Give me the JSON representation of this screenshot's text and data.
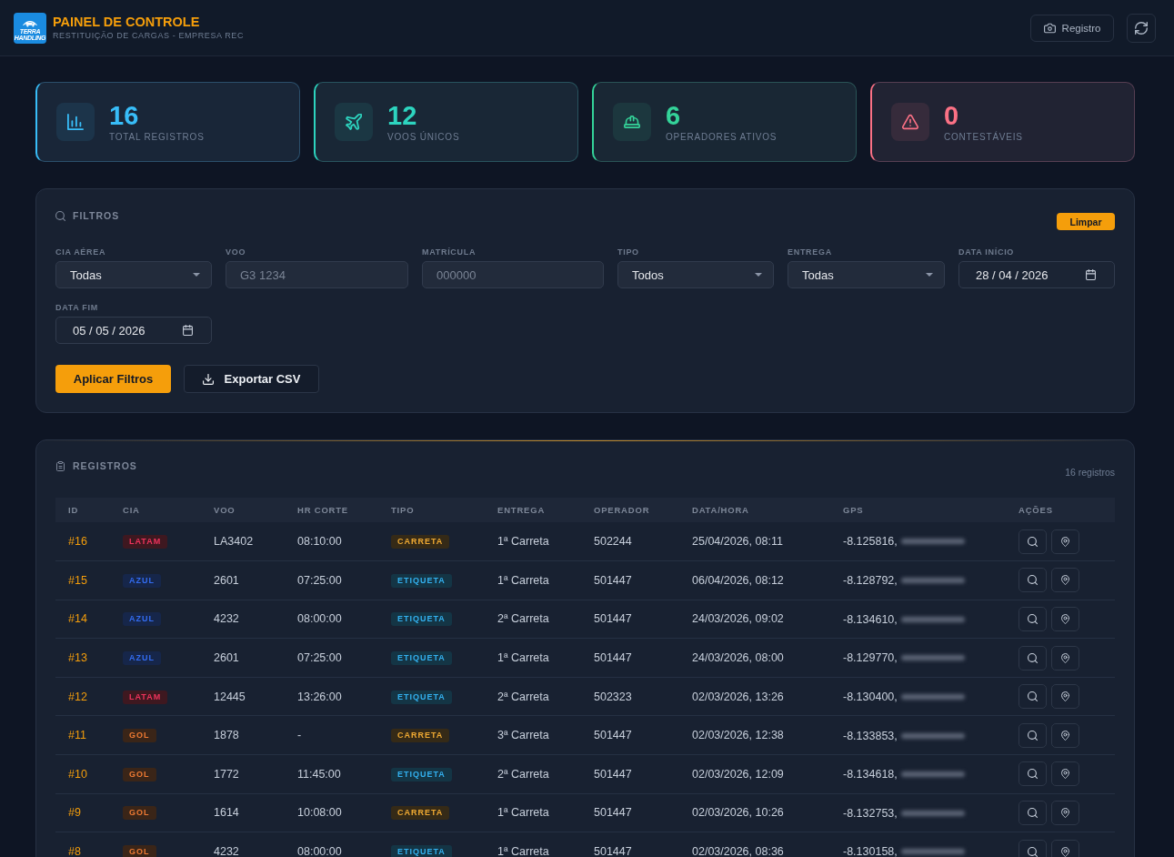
{
  "header": {
    "logo_text": [
      "TERRA",
      "HANDLING"
    ],
    "title": "PAINEL DE CONTROLE",
    "subtitle": "RESTITUIÇÃO DE CARGAS - EMPRESA REC",
    "register_button": "Registro"
  },
  "stats": [
    {
      "kind": "chart",
      "value": "16",
      "label": "TOTAL REGISTROS",
      "color": "#38bdf8"
    },
    {
      "kind": "plane",
      "value": "12",
      "label": "VOOS ÚNICOS",
      "color": "#2dd4bf"
    },
    {
      "kind": "helmet",
      "value": "6",
      "label": "OPERADORES ATIVOS",
      "color": "#34d399"
    },
    {
      "kind": "warning",
      "value": "0",
      "label": "CONTESTÁVEIS",
      "color": "#fb7185"
    }
  ],
  "filters": {
    "title": "FILTROS",
    "clear_button": "Limpar",
    "fields": [
      {
        "kind": "select",
        "label": "CIA AÉREA",
        "value": "Todas"
      },
      {
        "kind": "text",
        "label": "VOO",
        "placeholder": "G3 1234"
      },
      {
        "kind": "text",
        "label": "MATRÍCULA",
        "placeholder": "000000"
      },
      {
        "kind": "select",
        "label": "TIPO",
        "value": "Todos"
      },
      {
        "kind": "select",
        "label": "ENTREGA",
        "value": "Todas"
      },
      {
        "kind": "date",
        "label": "DATA INÍCIO",
        "value": "28 / 04 / 2026"
      },
      {
        "kind": "date",
        "label": "DATA FIM",
        "value": "05 / 05 / 2026"
      }
    ],
    "apply_button": "Aplicar Filtros",
    "export_button": "Exportar CSV"
  },
  "records": {
    "title": "REGISTROS",
    "count": "16 registros",
    "columns": [
      "ID",
      "CIA",
      "VOO",
      "HR CORTE",
      "TIPO",
      "ENTREGA",
      "OPERADOR",
      "DATA/HORA",
      "GPS",
      "AÇÕES"
    ],
    "rows": [
      {
        "id": "#16",
        "cia": {
          "label": "LATAM",
          "color": "#3e1820"
        },
        "voo": "LA3402",
        "hr_corte": "08:10:00",
        "tipo": {
          "label": "CARRETA",
          "color": "#352a17"
        },
        "entrega": "1ª Carreta",
        "operador": "502244",
        "data_hora": "25/04/2026, 08:11",
        "gps": "-8.125816,"
      },
      {
        "id": "#15",
        "cia": {
          "label": "AZUL",
          "color": "#16264a"
        },
        "voo": "2601",
        "hr_corte": "07:25:00",
        "tipo": {
          "label": "ETIQUETA",
          "color": "#143545"
        },
        "entrega": "1ª Carreta",
        "operador": "501447",
        "data_hora": "06/04/2026, 08:12",
        "gps": "-8.128792,"
      },
      {
        "id": "#14",
        "cia": {
          "label": "AZUL",
          "color": "#16264a"
        },
        "voo": "4232",
        "hr_corte": "08:00:00",
        "tipo": {
          "label": "ETIQUETA",
          "color": "#143545"
        },
        "entrega": "2ª Carreta",
        "operador": "501447",
        "data_hora": "24/03/2026, 09:02",
        "gps": "-8.134610,"
      },
      {
        "id": "#13",
        "cia": {
          "label": "AZUL",
          "color": "#16264a"
        },
        "voo": "2601",
        "hr_corte": "07:25:00",
        "tipo": {
          "label": "ETIQUETA",
          "color": "#143545"
        },
        "entrega": "1ª Carreta",
        "operador": "501447",
        "data_hora": "24/03/2026, 08:00",
        "gps": "-8.129770,"
      },
      {
        "id": "#12",
        "cia": {
          "label": "LATAM",
          "color": "#3e1820"
        },
        "voo": "12445",
        "hr_corte": "13:26:00",
        "tipo": {
          "label": "ETIQUETA",
          "color": "#143545"
        },
        "entrega": "2ª Carreta",
        "operador": "502323",
        "data_hora": "02/03/2026, 13:26",
        "gps": "-8.130400,"
      },
      {
        "id": "#11",
        "cia": {
          "label": "GOL",
          "color": "#3a2518"
        },
        "voo": "1878",
        "hr_corte": "-",
        "tipo": {
          "label": "CARRETA",
          "color": "#352a17"
        },
        "entrega": "3ª Carreta",
        "operador": "501447",
        "data_hora": "02/03/2026, 12:38",
        "gps": "-8.133853,"
      },
      {
        "id": "#10",
        "cia": {
          "label": "GOL",
          "color": "#3a2518"
        },
        "voo": "1772",
        "hr_corte": "11:45:00",
        "tipo": {
          "label": "ETIQUETA",
          "color": "#143545"
        },
        "entrega": "2ª Carreta",
        "operador": "501447",
        "data_hora": "02/03/2026, 12:09",
        "gps": "-8.134618,"
      },
      {
        "id": "#9",
        "cia": {
          "label": "GOL",
          "color": "#3a2518"
        },
        "voo": "1614",
        "hr_corte": "10:08:00",
        "tipo": {
          "label": "CARRETA",
          "color": "#352a17"
        },
        "entrega": "1ª Carreta",
        "operador": "501447",
        "data_hora": "02/03/2026, 10:26",
        "gps": "-8.132753,"
      },
      {
        "id": "#8",
        "cia": {
          "label": "GOL",
          "color": "#3a2518"
        },
        "voo": "4232",
        "hr_corte": "08:00:00",
        "tipo": {
          "label": "ETIQUETA",
          "color": "#143545"
        },
        "entrega": "1ª Carreta",
        "operador": "501447",
        "data_hora": "02/03/2026, 08:36",
        "gps": "-8.130158,"
      }
    ]
  }
}
